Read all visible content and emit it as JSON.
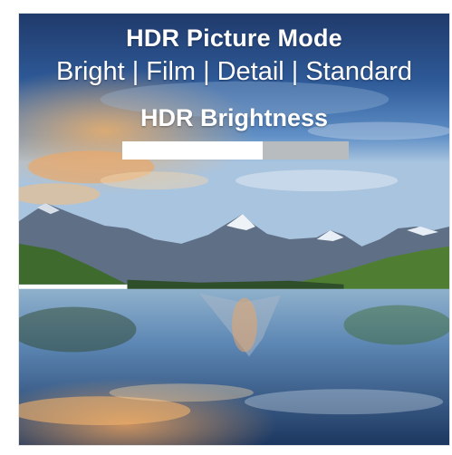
{
  "overlay": {
    "title": "HDR Picture Mode",
    "modes": [
      "Bright",
      "Film",
      "Detail",
      "Standard"
    ],
    "mode_separator": "|",
    "brightness_label": "HDR Brightness",
    "brightness_level": 0.62
  },
  "colors": {
    "bar_fill": "#ffffff",
    "bar_track": "#b9bcbf",
    "text": "#ffffff"
  }
}
